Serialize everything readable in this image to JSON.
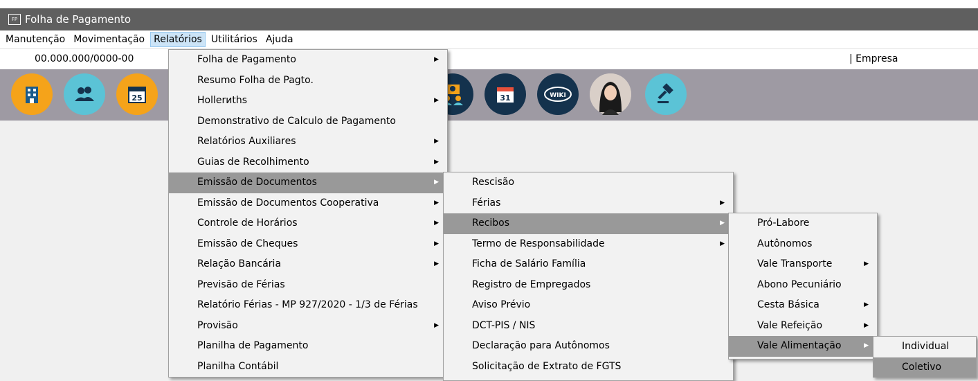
{
  "window": {
    "title": "Folha de Pagamento",
    "icon_text": "FP"
  },
  "menubar": [
    {
      "label": "Manutenção"
    },
    {
      "label": "Movimentação"
    },
    {
      "label": "Relatórios"
    },
    {
      "label": "Utilitários"
    },
    {
      "label": "Ajuda"
    }
  ],
  "infobar": {
    "cnpj": "00.000.000/0000-00",
    "empresa": "| Empresa"
  },
  "toolbar": {
    "left_icons": [
      "building-icon",
      "users-icon",
      "calendar-25-icon"
    ],
    "right_icons": [
      "employees-icon",
      "calendar-31-icon",
      "wiki-icon",
      "assistant-avatar-icon",
      "gavel-icon"
    ],
    "calendar_left_day": "25",
    "calendar_right_day": "31",
    "wiki_text": "WIKI"
  },
  "menu_relatorios": [
    {
      "label": "Folha de Pagamento",
      "submenu": true
    },
    {
      "label": "Resumo Folha de Pagto.",
      "submenu": false
    },
    {
      "label": "Hollerиths",
      "submenu": true
    },
    {
      "label": "Demonstrativo de Calculo de Pagamento",
      "submenu": false
    },
    {
      "label": "Relatórios Auxiliares",
      "submenu": true
    },
    {
      "label": "Guias de Recolhimento",
      "submenu": true
    },
    {
      "label": "Emissão de Documentos",
      "submenu": true,
      "highlighted": true
    },
    {
      "label": "Emissão de Documentos Cooperativa",
      "submenu": true
    },
    {
      "label": "Controle de Horários",
      "submenu": true
    },
    {
      "label": "Emissão de Cheques",
      "submenu": true
    },
    {
      "label": "Relação Bancária",
      "submenu": true
    },
    {
      "label": "Previsão de Férias",
      "submenu": false
    },
    {
      "label": "Relatório Férias - MP 927/2020 - 1/3 de Férias",
      "submenu": false
    },
    {
      "label": "Provisão",
      "submenu": true
    },
    {
      "label": "Planilha de Pagamento",
      "submenu": false
    },
    {
      "label": "Planilha Contábil",
      "submenu": false
    }
  ],
  "menu_emissao": [
    {
      "label": "Rescisão",
      "submenu": false
    },
    {
      "label": "Férias",
      "submenu": true
    },
    {
      "label": "Recibos",
      "submenu": true,
      "highlighted": true
    },
    {
      "label": "Termo de Responsabilidade",
      "submenu": true
    },
    {
      "label": "Ficha de Salário Família",
      "submenu": false
    },
    {
      "label": "Registro de Empregados",
      "submenu": false
    },
    {
      "label": "Aviso Prévio",
      "submenu": false
    },
    {
      "label": "DCT-PIS / NIS",
      "submenu": false
    },
    {
      "label": "Declaração para Autônomos",
      "submenu": false
    },
    {
      "label": "Solicitação de Extrato de FGTS",
      "submenu": false
    }
  ],
  "menu_recibos": [
    {
      "label": "Pró-Labore",
      "submenu": false
    },
    {
      "label": "Autônomos",
      "submenu": false
    },
    {
      "label": "Vale Transporte",
      "submenu": true
    },
    {
      "label": "Abono Pecuniário",
      "submenu": false
    },
    {
      "label": "Cesta Básica",
      "submenu": true
    },
    {
      "label": "Vale Refeição",
      "submenu": true
    },
    {
      "label": "Vale Alimentação",
      "submenu": true,
      "highlighted": true
    }
  ],
  "menu_vale_alimentacao": [
    {
      "label": "Individual",
      "submenu": false
    },
    {
      "label": "Coletivo",
      "submenu": false,
      "highlighted": true
    }
  ],
  "colors": {
    "titlebar": "#5f5f5f",
    "toolbar": "#9e9aa3",
    "menu_highlight": "#999999",
    "icon_orange": "#f5a31a",
    "icon_teal": "#5bc3d6",
    "icon_navy": "#14324d"
  }
}
